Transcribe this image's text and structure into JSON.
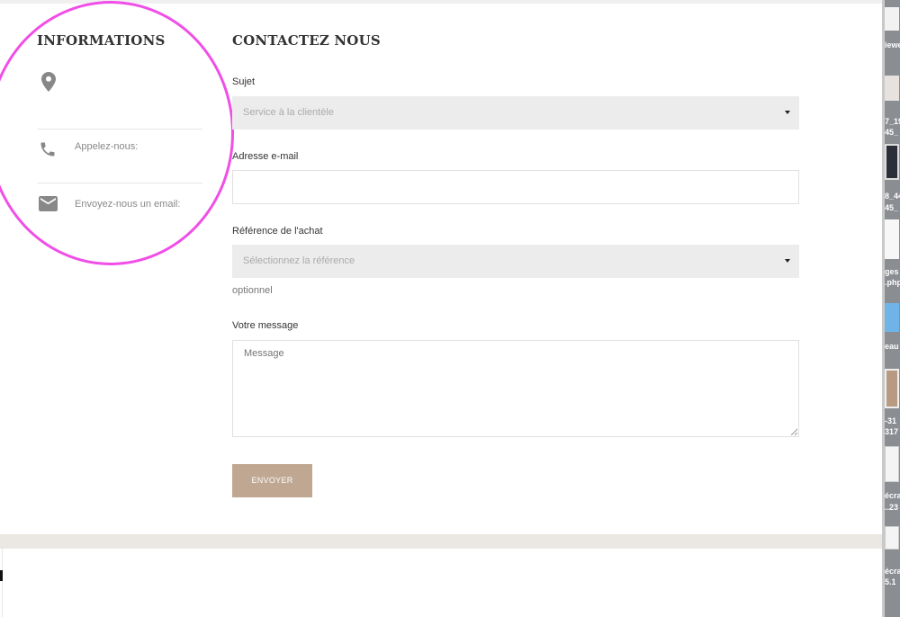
{
  "info": {
    "title": "INFORMATIONS",
    "phone_label": "Appelez-nous:",
    "email_label": "Envoyez-nous un email:"
  },
  "contact": {
    "title": "CONTACTEZ NOUS",
    "subject_label": "Sujet",
    "subject_value": "Service à la clientèle",
    "email_label": "Adresse e-mail",
    "reference_label": "Référence de l'achat",
    "reference_value": "Sélectionnez la référence",
    "optional_hint": "optionnel",
    "message_label": "Votre message",
    "message_placeholder": "Message",
    "submit_label": "ENVOYER"
  },
  "desktop": {
    "labels": [
      "iewe",
      "7_19",
      "45_",
      "8_44",
      "45_",
      "ges",
      ".php",
      "eau",
      "-31",
      "317",
      "écra",
      "..23",
      "écra",
      "5.1"
    ]
  },
  "colors": {
    "annotation_circle": "#f04ee6",
    "button": "#bfa791",
    "select_bg": "#ececec"
  }
}
